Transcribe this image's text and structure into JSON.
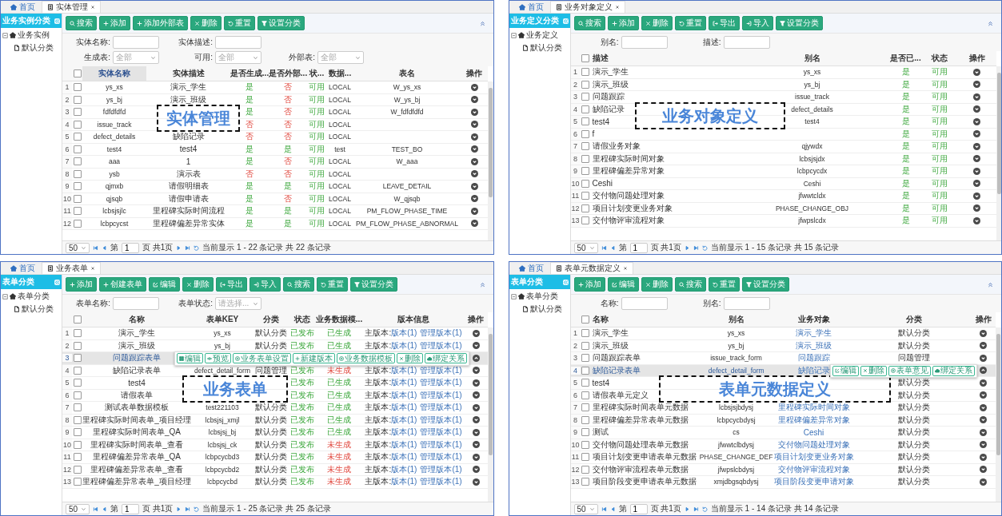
{
  "panels": [
    {
      "tabs": [
        {
          "label": "首页",
          "kind": "home",
          "selected": false,
          "closable": false
        },
        {
          "label": "实体管理",
          "kind": "page",
          "selected": true,
          "closable": true
        }
      ],
      "sidebar": {
        "title": "业务实例分类",
        "tree": [
          {
            "label": "业务实例",
            "expanded": true,
            "children": [
              {
                "label": "默认分类"
              }
            ]
          }
        ]
      },
      "toolbar": [
        {
          "label": "搜索",
          "kind": "search"
        },
        {
          "label": "添加",
          "kind": "add"
        },
        {
          "label": "添加外部表",
          "kind": "add"
        },
        {
          "label": "删除",
          "kind": "delete"
        },
        {
          "label": "重置",
          "kind": "reset"
        },
        {
          "label": "设置分类",
          "kind": "filter"
        }
      ],
      "filters": [
        [
          {
            "label": "实体名称:",
            "kind": "text"
          },
          {
            "label": "实体描述:",
            "kind": "text"
          }
        ],
        [
          {
            "label": "生成表:",
            "kind": "select",
            "placeholder": "全部"
          },
          {
            "label": "可用:",
            "kind": "select",
            "placeholder": "全部"
          },
          {
            "label": "外部表:",
            "kind": "select",
            "placeholder": "全部"
          }
        ]
      ],
      "table": {
        "all_checked": false,
        "columns": [
          {
            "label": "实体名称",
            "sorted": true
          },
          {
            "label": "实体描述",
            "sorted": false
          },
          {
            "label": "是否生成...",
            "sorted": false
          },
          {
            "label": "是否外部...",
            "sorted": false
          },
          {
            "label": "状...",
            "sorted": false
          },
          {
            "label": "数据...",
            "sorted": false
          },
          {
            "label": "表名",
            "sorted": false
          },
          {
            "label": "操作",
            "sorted": false
          }
        ],
        "rows": [
          {
            "num": "1",
            "checked": false,
            "selected": false,
            "expanded": false,
            "cells": [
              "ys_xs",
              "演示_学生",
              {
                "text": "是",
                "kind": "ok"
              },
              {
                "text": "否",
                "kind": "bad"
              },
              {
                "text": "可用",
                "kind": "ok"
              },
              "LOCAL",
              "W_ys_xs"
            ]
          },
          {
            "num": "2",
            "checked": false,
            "selected": false,
            "expanded": false,
            "cells": [
              "ys_bj",
              "演示_班级",
              {
                "text": "是",
                "kind": "ok"
              },
              {
                "text": "否",
                "kind": "bad"
              },
              {
                "text": "可用",
                "kind": "ok"
              },
              "LOCAL",
              "W_ys_bj"
            ]
          },
          {
            "num": "3",
            "checked": false,
            "selected": false,
            "expanded": false,
            "cells": [
              "fdfdfdfd",
              null,
              {
                "text": "是",
                "kind": "ok"
              },
              {
                "text": "否",
                "kind": "bad"
              },
              {
                "text": "可用",
                "kind": "ok"
              },
              "LOCAL",
              "W_fdfdfdfd"
            ]
          },
          {
            "num": "4",
            "checked": false,
            "selected": false,
            "expanded": false,
            "cells": [
              "issue_track",
              null,
              {
                "text": "否",
                "kind": "bad"
              },
              {
                "text": "否",
                "kind": "bad"
              },
              {
                "text": "可用",
                "kind": "ok"
              },
              "LOCAL",
              null
            ]
          },
          {
            "num": "5",
            "checked": false,
            "selected": false,
            "expanded": false,
            "cells": [
              "defect_details",
              "缺陷记录",
              {
                "text": "否",
                "kind": "bad"
              },
              {
                "text": "否",
                "kind": "bad"
              },
              {
                "text": "可用",
                "kind": "ok"
              },
              "LOCAL",
              null
            ]
          },
          {
            "num": "6",
            "checked": false,
            "selected": false,
            "expanded": false,
            "cells": [
              "test4",
              "test4",
              {
                "text": "是",
                "kind": "ok"
              },
              {
                "text": "是",
                "kind": "ok"
              },
              {
                "text": "可用",
                "kind": "ok"
              },
              "test",
              "TEST_BO"
            ]
          },
          {
            "num": "7",
            "checked": false,
            "selected": false,
            "expanded": false,
            "cells": [
              "aaa",
              "1",
              {
                "text": "是",
                "kind": "ok"
              },
              {
                "text": "否",
                "kind": "bad"
              },
              {
                "text": "可用",
                "kind": "ok"
              },
              "LOCAL",
              "W_aaa"
            ]
          },
          {
            "num": "8",
            "checked": false,
            "selected": false,
            "expanded": false,
            "cells": [
              "ysb",
              "演示表",
              {
                "text": "否",
                "kind": "bad"
              },
              {
                "text": "否",
                "kind": "bad"
              },
              {
                "text": "可用",
                "kind": "ok"
              },
              "LOCAL",
              null
            ]
          },
          {
            "num": "9",
            "checked": false,
            "selected": false,
            "expanded": false,
            "cells": [
              "qjmxb",
              "请假明细表",
              {
                "text": "是",
                "kind": "ok"
              },
              {
                "text": "是",
                "kind": "ok"
              },
              {
                "text": "可用",
                "kind": "ok"
              },
              "LOCAL",
              "LEAVE_DETAIL"
            ]
          },
          {
            "num": "10",
            "checked": false,
            "selected": false,
            "expanded": false,
            "cells": [
              "qjsqb",
              "请假申请表",
              {
                "text": "是",
                "kind": "ok"
              },
              {
                "text": "否",
                "kind": "bad"
              },
              {
                "text": "可用",
                "kind": "ok"
              },
              "LOCAL",
              "W_qjsqb"
            ]
          },
          {
            "num": "11",
            "checked": false,
            "selected": false,
            "expanded": false,
            "cells": [
              "lcbsjsjlc",
              "里程碑实际时间流程",
              {
                "text": "是",
                "kind": "ok"
              },
              {
                "text": "是",
                "kind": "ok"
              },
              {
                "text": "可用",
                "kind": "ok"
              },
              "LOCAL",
              "PM_FLOW_PHASE_TIME"
            ]
          },
          {
            "num": "12",
            "checked": false,
            "selected": false,
            "expanded": false,
            "cells": [
              "lcbpcycst",
              "里程碑偏差异常实体",
              {
                "text": "是",
                "kind": "ok"
              },
              {
                "text": "是",
                "kind": "ok"
              },
              {
                "text": "可用",
                "kind": "ok"
              },
              "LOCAL",
              "PM_FLOW_PHASE_ABNORMAL"
            ]
          }
        ]
      },
      "pager": {
        "page_size": "50",
        "page_label": "第",
        "page": "1",
        "page_total": "页 共1页",
        "info": "当前显示 1 - 22 条记录 共 22 条记录"
      },
      "caption": "实体管理"
    },
    {
      "tabs": [
        {
          "label": "首页",
          "kind": "home",
          "selected": false,
          "closable": false
        },
        {
          "label": "业务对象定义",
          "kind": "page",
          "selected": true,
          "closable": true
        }
      ],
      "sidebar": {
        "title": "业务定义分类",
        "tree": [
          {
            "label": "业务定义",
            "expanded": true,
            "children": [
              {
                "label": "默认分类"
              }
            ]
          }
        ]
      },
      "toolbar": [
        {
          "label": "搜索",
          "kind": "search"
        },
        {
          "label": "添加",
          "kind": "add"
        },
        {
          "label": "删除",
          "kind": "delete"
        },
        {
          "label": "重置",
          "kind": "reset"
        },
        {
          "label": "导出",
          "kind": "export"
        },
        {
          "label": "导入",
          "kind": "import"
        },
        {
          "label": "设置分类",
          "kind": "filter"
        }
      ],
      "filters": [
        [
          {
            "label": "别名:",
            "kind": "text"
          },
          {
            "label": "描述:",
            "kind": "text"
          }
        ]
      ],
      "table": {
        "all_checked": false,
        "columns": [
          {
            "label": "描述"
          },
          {
            "label": "别名"
          },
          {
            "label": "是否已..."
          },
          {
            "label": "状态"
          },
          {
            "label": "操作"
          }
        ],
        "rows": [
          {
            "num": "1",
            "checked": false,
            "selected": false,
            "expanded": false,
            "cells": [
              "演示_学生",
              "ys_xs",
              {
                "text": "是",
                "kind": "ok"
              },
              {
                "text": "可用",
                "kind": "ok"
              }
            ]
          },
          {
            "num": "2",
            "checked": false,
            "selected": false,
            "expanded": false,
            "cells": [
              "演示_班级",
              "ys_bj",
              {
                "text": "是",
                "kind": "ok"
              },
              {
                "text": "可用",
                "kind": "ok"
              }
            ]
          },
          {
            "num": "3",
            "checked": false,
            "selected": false,
            "expanded": false,
            "cells": [
              "问题跟踪",
              "issue_track",
              {
                "text": "是",
                "kind": "ok"
              },
              {
                "text": "可用",
                "kind": "ok"
              }
            ]
          },
          {
            "num": "4",
            "checked": false,
            "selected": false,
            "expanded": false,
            "cells": [
              "缺陷记录",
              "defect_details",
              {
                "text": "是",
                "kind": "ok"
              },
              {
                "text": "可用",
                "kind": "ok"
              }
            ]
          },
          {
            "num": "5",
            "checked": false,
            "selected": false,
            "expanded": false,
            "cells": [
              "test4",
              "test4",
              {
                "text": "是",
                "kind": "ok"
              },
              {
                "text": "可用",
                "kind": "ok"
              }
            ]
          },
          {
            "num": "6",
            "checked": false,
            "selected": false,
            "expanded": false,
            "cells": [
              "f",
              null,
              {
                "text": "是",
                "kind": "ok"
              },
              {
                "text": "可用",
                "kind": "ok"
              }
            ]
          },
          {
            "num": "7",
            "checked": false,
            "selected": false,
            "expanded": false,
            "cells": [
              "请假业务对象",
              "qjywdx",
              {
                "text": "是",
                "kind": "ok"
              },
              {
                "text": "可用",
                "kind": "ok"
              }
            ]
          },
          {
            "num": "8",
            "checked": false,
            "selected": false,
            "expanded": false,
            "cells": [
              "里程碑实际时间对象",
              "lcbsjsjdx",
              {
                "text": "是",
                "kind": "ok"
              },
              {
                "text": "可用",
                "kind": "ok"
              }
            ]
          },
          {
            "num": "9",
            "checked": false,
            "selected": false,
            "expanded": false,
            "cells": [
              "里程碑偏差异常对象",
              "lcbpcycdx",
              {
                "text": "是",
                "kind": "ok"
              },
              {
                "text": "可用",
                "kind": "ok"
              }
            ]
          },
          {
            "num": "10",
            "checked": false,
            "selected": false,
            "expanded": false,
            "cells": [
              "Ceshi",
              "Ceshi",
              {
                "text": "是",
                "kind": "ok"
              },
              {
                "text": "可用",
                "kind": "ok"
              }
            ]
          },
          {
            "num": "11",
            "checked": false,
            "selected": false,
            "expanded": false,
            "cells": [
              "交付物问题处理对象",
              "jfwwtcldx",
              {
                "text": "是",
                "kind": "ok"
              },
              {
                "text": "可用",
                "kind": "ok"
              }
            ]
          },
          {
            "num": "12",
            "checked": false,
            "selected": false,
            "expanded": false,
            "cells": [
              "项目计划变更业务对象",
              "PHASE_CHANGE_OBJ",
              {
                "text": "是",
                "kind": "ok"
              },
              {
                "text": "可用",
                "kind": "ok"
              }
            ]
          },
          {
            "num": "13",
            "checked": false,
            "selected": false,
            "expanded": false,
            "cells": [
              "交付物评审流程对象",
              "jfwpslcdx",
              {
                "text": "是",
                "kind": "ok"
              },
              {
                "text": "可用",
                "kind": "ok"
              }
            ]
          }
        ]
      },
      "pager": {
        "page_size": "50",
        "page_label": "第",
        "page": "1",
        "page_total": "页 共1页",
        "info": "当前显示 1 - 15 条记录 共 15 条记录"
      },
      "caption": "业务对象定义"
    },
    {
      "tabs": [
        {
          "label": "首页",
          "kind": "home",
          "selected": false,
          "closable": false
        },
        {
          "label": "业务表单",
          "kind": "page",
          "selected": true,
          "closable": true
        }
      ],
      "sidebar": {
        "title": "表单分类",
        "tree": [
          {
            "label": "表单分类",
            "expanded": true,
            "children": [
              {
                "label": "默认分类"
              }
            ]
          }
        ]
      },
      "toolbar": [
        {
          "label": "添加",
          "kind": "add"
        },
        {
          "label": "创建表单",
          "kind": "add"
        },
        {
          "label": "编辑",
          "kind": "edit"
        },
        {
          "label": "删除",
          "kind": "delete"
        },
        {
          "label": "导出",
          "kind": "export"
        },
        {
          "label": "导入",
          "kind": "import"
        },
        {
          "label": "搜索",
          "kind": "search"
        },
        {
          "label": "重置",
          "kind": "reset"
        },
        {
          "label": "设置分类",
          "kind": "filter"
        }
      ],
      "filters": [
        [
          {
            "label": "表单名称:",
            "kind": "text"
          },
          {
            "label": "表单状态:",
            "kind": "select",
            "placeholder": "请选择..."
          }
        ]
      ],
      "table": {
        "all_checked": false,
        "columns": [
          {
            "label": "名称"
          },
          {
            "label": "表单KEY"
          },
          {
            "label": "分类"
          },
          {
            "label": "状态"
          },
          {
            "label": "业务数据模..."
          },
          {
            "label": "版本信息"
          },
          {
            "label": "操作"
          }
        ],
        "rows": [
          {
            "num": "1",
            "checked": false,
            "selected": false,
            "expanded": false,
            "cells": [
              "演示_学生",
              "ys_xs",
              "默认分类",
              {
                "text": "已发布",
                "kind": "ok"
              },
              {
                "text": "已生成",
                "kind": "ok"
              },
              {
                "kind": "versions",
                "label": "主版本:",
                "links": [
                  "版本(1)",
                  "管理版本(1)"
                ]
              }
            ]
          },
          {
            "num": "2",
            "checked": false,
            "selected": false,
            "expanded": false,
            "cells": [
              "演示_班级",
              "ys_bj",
              "默认分类",
              {
                "text": "已发布",
                "kind": "ok"
              },
              {
                "text": "已生成",
                "kind": "ok"
              },
              {
                "kind": "versions",
                "label": "主版本:",
                "links": [
                  "版本(1)",
                  "管理版本(1)"
                ]
              }
            ]
          },
          {
            "num": "3",
            "checked": false,
            "selected": true,
            "expanded": true,
            "cells": [
              "问题跟踪表单",
              null,
              null,
              null,
              null,
              null
            ],
            "actions": [
              {
                "label": "编辑",
                "kind": "grid"
              },
              {
                "label": "预览",
                "kind": "eye"
              },
              {
                "label": "业务表单设置",
                "kind": "gear"
              },
              {
                "label": "新建版本",
                "kind": "add"
              },
              {
                "label": "业务数据模板",
                "kind": "gear"
              },
              {
                "label": "删除",
                "kind": "delete"
              },
              {
                "label": "绑定关系",
                "kind": "cloud"
              }
            ]
          },
          {
            "num": "4",
            "checked": false,
            "selected": false,
            "expanded": false,
            "cells": [
              "缺陷记录表单",
              "defect_detail_form",
              "问题管理",
              {
                "text": "已发布",
                "kind": "ok"
              },
              {
                "text": "未生成",
                "kind": "bad"
              },
              {
                "kind": "versions",
                "label": "主版本:",
                "links": [
                  "版本(1)",
                  "管理版本(1)"
                ]
              }
            ]
          },
          {
            "num": "5",
            "checked": false,
            "selected": false,
            "expanded": false,
            "cells": [
              "test4",
              null,
              null,
              {
                "text": "已发布",
                "kind": "ok"
              },
              {
                "text": "已生成",
                "kind": "ok"
              },
              {
                "kind": "versions",
                "label": "主版本:",
                "links": [
                  "版本(1)",
                  "管理版本(1)"
                ]
              }
            ]
          },
          {
            "num": "6",
            "checked": false,
            "selected": false,
            "expanded": false,
            "cells": [
              "请假表单",
              null,
              null,
              {
                "text": "已发布",
                "kind": "ok"
              },
              {
                "text": "已生成",
                "kind": "ok"
              },
              {
                "kind": "versions",
                "label": "主版本:",
                "links": [
                  "版本(1)",
                  "管理版本(1)"
                ]
              }
            ]
          },
          {
            "num": "7",
            "checked": false,
            "selected": false,
            "expanded": false,
            "cells": [
              "测试表单数据模板",
              "test221103",
              "默认分类",
              {
                "text": "已发布",
                "kind": "ok"
              },
              {
                "text": "已生成",
                "kind": "ok"
              },
              {
                "kind": "versions",
                "label": "主版本:",
                "links": [
                  "版本(1)",
                  "管理版本(1)"
                ]
              }
            ]
          },
          {
            "num": "8",
            "checked": false,
            "selected": false,
            "expanded": false,
            "cells": [
              "里程碑实际时间表单_项目经理",
              "lcbsjsj_xmjl",
              "默认分类",
              {
                "text": "已发布",
                "kind": "ok"
              },
              {
                "text": "已生成",
                "kind": "ok"
              },
              {
                "kind": "versions",
                "label": "主版本:",
                "links": [
                  "版本(1)",
                  "管理版本(1)"
                ]
              }
            ]
          },
          {
            "num": "9",
            "checked": false,
            "selected": false,
            "expanded": false,
            "cells": [
              "里程碑实际时间表单_QA",
              "lcbsjsj_bj",
              "默认分类",
              {
                "text": "已发布",
                "kind": "ok"
              },
              {
                "text": "已生成",
                "kind": "ok"
              },
              {
                "kind": "versions",
                "label": "主版本:",
                "links": [
                  "版本(1)",
                  "管理版本(1)"
                ]
              }
            ]
          },
          {
            "num": "10",
            "checked": false,
            "selected": false,
            "expanded": false,
            "cells": [
              "里程碑实际时间表单_查看",
              "lcbsjsj_ck",
              "默认分类",
              {
                "text": "已发布",
                "kind": "ok"
              },
              {
                "text": "未生成",
                "kind": "bad"
              },
              {
                "kind": "versions",
                "label": "主版本:",
                "links": [
                  "版本(1)",
                  "管理版本(1)"
                ]
              }
            ]
          },
          {
            "num": "11",
            "checked": false,
            "selected": false,
            "expanded": false,
            "cells": [
              "里程碑偏差异常表单_QA",
              "lcbpcycbd3",
              "默认分类",
              {
                "text": "已发布",
                "kind": "ok"
              },
              {
                "text": "未生成",
                "kind": "bad"
              },
              {
                "kind": "versions",
                "label": "主版本:",
                "links": [
                  "版本(1)",
                  "管理版本(1)"
                ]
              }
            ]
          },
          {
            "num": "12",
            "checked": false,
            "selected": false,
            "expanded": false,
            "cells": [
              "里程碑偏差异常表单_查看",
              "lcbpcycbd2",
              "默认分类",
              {
                "text": "已发布",
                "kind": "ok"
              },
              {
                "text": "未生成",
                "kind": "bad"
              },
              {
                "kind": "versions",
                "label": "主版本:",
                "links": [
                  "版本(1)",
                  "管理版本(1)"
                ]
              }
            ]
          },
          {
            "num": "13",
            "checked": false,
            "selected": false,
            "expanded": false,
            "cells": [
              "里程碑偏差异常表单_项目经理",
              "lcbpcycbd",
              "默认分类",
              {
                "text": "已发布",
                "kind": "ok"
              },
              {
                "text": "未生成",
                "kind": "bad"
              },
              {
                "kind": "versions",
                "label": "主版本:",
                "links": [
                  "版本(1)",
                  "管理版本(1)"
                ]
              }
            ]
          }
        ]
      },
      "pager": {
        "page_size": "50",
        "page_label": "第",
        "page": "1",
        "page_total": "页 共1页",
        "info": "当前显示 1 - 25 条记录 共 25 条记录"
      },
      "caption": "业务表单"
    },
    {
      "tabs": [
        {
          "label": "首页",
          "kind": "home",
          "selected": false,
          "closable": false
        },
        {
          "label": "表单元数据定义",
          "kind": "page",
          "selected": true,
          "closable": true
        }
      ],
      "sidebar": {
        "title": "表单分类",
        "tree": [
          {
            "label": "表单分类",
            "expanded": true,
            "children": [
              {
                "label": "默认分类"
              }
            ]
          }
        ]
      },
      "toolbar": [
        {
          "label": "添加",
          "kind": "add"
        },
        {
          "label": "编辑",
          "kind": "edit"
        },
        {
          "label": "删除",
          "kind": "delete"
        },
        {
          "label": "搜索",
          "kind": "search"
        },
        {
          "label": "重置",
          "kind": "reset"
        },
        {
          "label": "设置分类",
          "kind": "filter"
        }
      ],
      "filters": [
        [
          {
            "label": "名称:",
            "kind": "text"
          },
          {
            "label": "别名:",
            "kind": "text"
          }
        ]
      ],
      "table": {
        "all_checked": false,
        "columns": [
          {
            "label": "名称"
          },
          {
            "label": "别名"
          },
          {
            "label": "业务对象"
          },
          {
            "label": "分类"
          },
          {
            "label": "操作"
          }
        ],
        "rows": [
          {
            "num": "1",
            "checked": false,
            "selected": false,
            "expanded": false,
            "cells": [
              "演示_学生",
              "ys_xs",
              {
                "text": "演示_学生",
                "kind": "link"
              },
              "默认分类"
            ]
          },
          {
            "num": "2",
            "checked": false,
            "selected": false,
            "expanded": false,
            "cells": [
              "演示_班级",
              "ys_bj",
              {
                "text": "演示_班级",
                "kind": "link"
              },
              "默认分类"
            ]
          },
          {
            "num": "3",
            "checked": false,
            "selected": false,
            "expanded": false,
            "cells": [
              "问题跟踪表单",
              "issue_track_form",
              {
                "text": "问题跟踪",
                "kind": "link"
              },
              "问题管理"
            ]
          },
          {
            "num": "4",
            "checked": false,
            "selected": true,
            "expanded": true,
            "cells": [
              "缺陷记录表单",
              "defect_detail_form",
              {
                "text": "缺陷记录",
                "kind": "link"
              },
              null
            ],
            "actions": [
              {
                "label": "编辑",
                "kind": "edit"
              },
              {
                "label": "删除",
                "kind": "delete"
              },
              {
                "label": "表单意见",
                "kind": "gear"
              },
              {
                "label": "绑定关系",
                "kind": "cloud"
              }
            ]
          },
          {
            "num": "5",
            "checked": false,
            "selected": false,
            "expanded": false,
            "cells": [
              "test4",
              null,
              null,
              "默认分类"
            ]
          },
          {
            "num": "6",
            "checked": false,
            "selected": false,
            "expanded": false,
            "cells": [
              "请假表单元定义",
              null,
              null,
              "默认分类"
            ]
          },
          {
            "num": "7",
            "checked": false,
            "selected": false,
            "expanded": false,
            "cells": [
              "里程碑实际时间表单元数据",
              "lcbsjsjbdysj",
              {
                "text": "里程碑实际时间对象",
                "kind": "link"
              },
              "默认分类"
            ]
          },
          {
            "num": "8",
            "checked": false,
            "selected": false,
            "expanded": false,
            "cells": [
              "里程碑偏差异常表单元数据",
              "lcbpcycbdysj",
              {
                "text": "里程碑偏差异常对象",
                "kind": "link"
              },
              "默认分类"
            ]
          },
          {
            "num": "9",
            "checked": false,
            "selected": false,
            "expanded": false,
            "cells": [
              "测试",
              "cs",
              {
                "text": "Ceshi",
                "kind": "link"
              },
              "默认分类"
            ]
          },
          {
            "num": "10",
            "checked": false,
            "selected": false,
            "expanded": false,
            "cells": [
              "交付物问题处理表单元数据",
              "jfwwtclbdysj",
              {
                "text": "交付物问题处理对象",
                "kind": "link"
              },
              "默认分类"
            ]
          },
          {
            "num": "11",
            "checked": false,
            "selected": false,
            "expanded": false,
            "cells": [
              "项目计划变更申请表单元数据",
              "PHASE_CHANGE_DEF",
              {
                "text": "项目计划变更业务对象",
                "kind": "link"
              },
              "默认分类"
            ]
          },
          {
            "num": "12",
            "checked": false,
            "selected": false,
            "expanded": false,
            "cells": [
              "交付物评审流程表单元数据",
              "jfwpslcbdysj",
              {
                "text": "交付物评审流程对象",
                "kind": "link"
              },
              "默认分类"
            ]
          },
          {
            "num": "13",
            "checked": false,
            "selected": false,
            "expanded": false,
            "cells": [
              "项目阶段变更申请表单元数据",
              "xmjdbgsqbdysj",
              {
                "text": "项目阶段变更申请对象",
                "kind": "link"
              },
              "默认分类"
            ]
          }
        ]
      },
      "pager": {
        "page_size": "50",
        "page_label": "第",
        "page": "1",
        "page_total": "页 共1页",
        "info": "当前显示 1 - 14 条记录 共 14 条记录"
      },
      "caption": "表单元数据定义"
    }
  ]
}
